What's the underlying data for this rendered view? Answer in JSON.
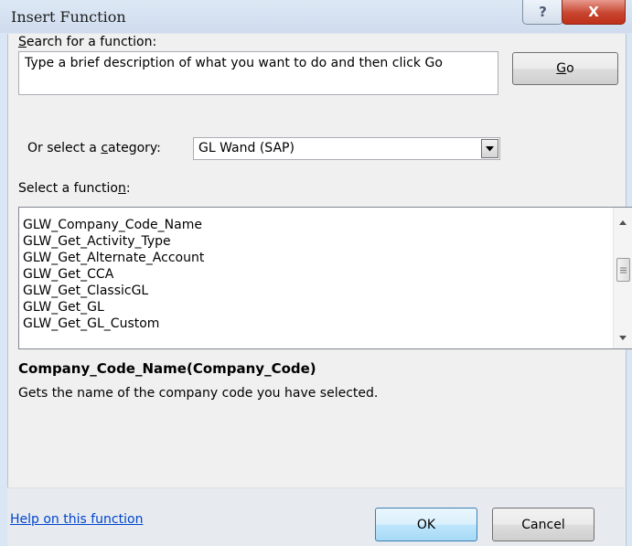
{
  "window": {
    "title": "Insert Function",
    "help_glyph": "?",
    "close_glyph": "X"
  },
  "search": {
    "label_prefix": "",
    "label_accel": "S",
    "label_rest": "earch for a function:",
    "value": "Type a brief description of what you want to do and then click Go",
    "go_accel": "G",
    "go_rest": "o"
  },
  "category": {
    "label_prefix": "Or select a ",
    "label_accel": "c",
    "label_rest": "ategory:",
    "selected": "GL Wand (SAP)"
  },
  "functions": {
    "label_prefix": "Select a functio",
    "label_accel": "n",
    "label_rest": ":",
    "items": [
      "GLW_Company_Code_Name",
      "GLW_Get_Activity_Type",
      "GLW_Get_Alternate_Account",
      "GLW_Get_CCA",
      "GLW_Get_ClassicGL",
      "GLW_Get_GL",
      "GLW_Get_GL_Custom"
    ],
    "selected_index": 0
  },
  "details": {
    "signature": "Company_Code_Name(Company_Code)",
    "description": "Gets the name of the company code you have selected."
  },
  "footer": {
    "help_link": "Help on this function",
    "ok_label": "OK",
    "cancel_label": "Cancel"
  },
  "icons": {
    "dropdown": "chevron-down-icon",
    "scroll_up": "scroll-up-arrow-icon",
    "scroll_down": "scroll-down-arrow-icon",
    "scroll_grip": "grip-icon"
  },
  "colors": {
    "link": "#0044cc",
    "close_button": "#c7452f",
    "titlebar": "#dbe6f4"
  }
}
